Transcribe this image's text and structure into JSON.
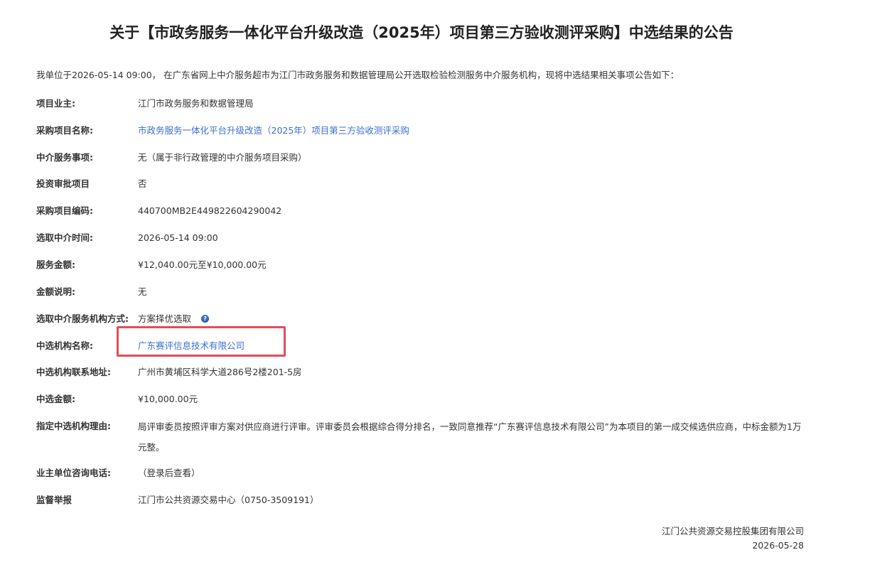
{
  "title": "关于【市政务服务一体化平台升级改造（2025年）项目第三方验收测评采购】中选结果的公告",
  "intro": "我单位于2026-05-14 09:00， 在广东省网上中介服务超市为江门市政务服务和数据管理局公开选取检验检测服务中介服务机构，现将中选结果相关事项公告如下：",
  "rows": [
    {
      "label": "项目业主:",
      "value": "江门市政务服务和数据管理局"
    },
    {
      "label": "采购项目名称:",
      "value": "市政务服务一体化平台升级改造（2025年）项目第三方验收测评采购"
    },
    {
      "label": "中介服务事项:",
      "value": "无（属于非行政管理的中介服务项目采购）"
    },
    {
      "label": "投资审批项目",
      "value": "否"
    },
    {
      "label": "采购项目编码:",
      "value": "440700MB2E449822604290042"
    },
    {
      "label": "选取中介时间:",
      "value": "2026-05-14 09:00"
    },
    {
      "label": "服务金额:",
      "value": "¥12,040.00元至¥10,000.00元"
    },
    {
      "label": "金额说明:",
      "value": "无"
    },
    {
      "label": "选取中介服务机构方式:",
      "value": "方案择优选取"
    },
    {
      "label": "中选机构名称:",
      "value": "广东赛评信息技术有限公司"
    },
    {
      "label": "中选机构联系地址:",
      "value": "广州市黄埔区科学大道286号2楼201-5房"
    },
    {
      "label": "中选金额:",
      "value": "¥10,000.00元"
    },
    {
      "label": "指定中选机构理由:",
      "value": "局评审委员按照评审方案对供应商进行评审。评审委员会根据综合得分排名，一致同意推荐“广东赛评信息技术有限公司”为本项目的第一成交候选供应商，中标金额为1万元整。"
    },
    {
      "label": "业主单位咨询电话:",
      "value": "（登录后查看）"
    },
    {
      "label": "监督举报",
      "value": "江门市公共资源交易中心（0750-3509191）"
    }
  ],
  "help_icon_glyph": "?",
  "accent_color": "#3b6fd1",
  "highlight_color": "#e04e5a",
  "footer": {
    "org": "江门公共资源交易控股集团有限公司",
    "date": "2026-05-28"
  }
}
